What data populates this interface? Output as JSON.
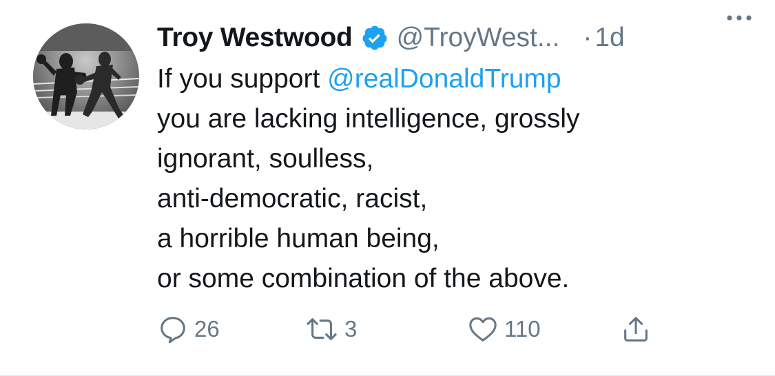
{
  "author": {
    "name": "Troy Westwood",
    "handle": "@TroyWest...",
    "separator": "·",
    "time": "1d"
  },
  "tweet": {
    "lines": [
      {
        "prefix": "If you support ",
        "mention": "@realDonaldTrump"
      },
      "you are lacking intelligence, grossly",
      "ignorant, soulless,",
      "anti-democratic, racist,",
      "a horrible human being,",
      "or some combination of the above."
    ]
  },
  "actions": {
    "reply": {
      "icon": "reply-icon",
      "count": "26"
    },
    "retweet": {
      "icon": "retweet-icon",
      "count": "3"
    },
    "like": {
      "icon": "heart-icon",
      "count": "110"
    },
    "share": {
      "icon": "share-icon"
    }
  },
  "colors": {
    "text": "#14171a",
    "muted": "#657786",
    "accent": "#1da1f2"
  }
}
